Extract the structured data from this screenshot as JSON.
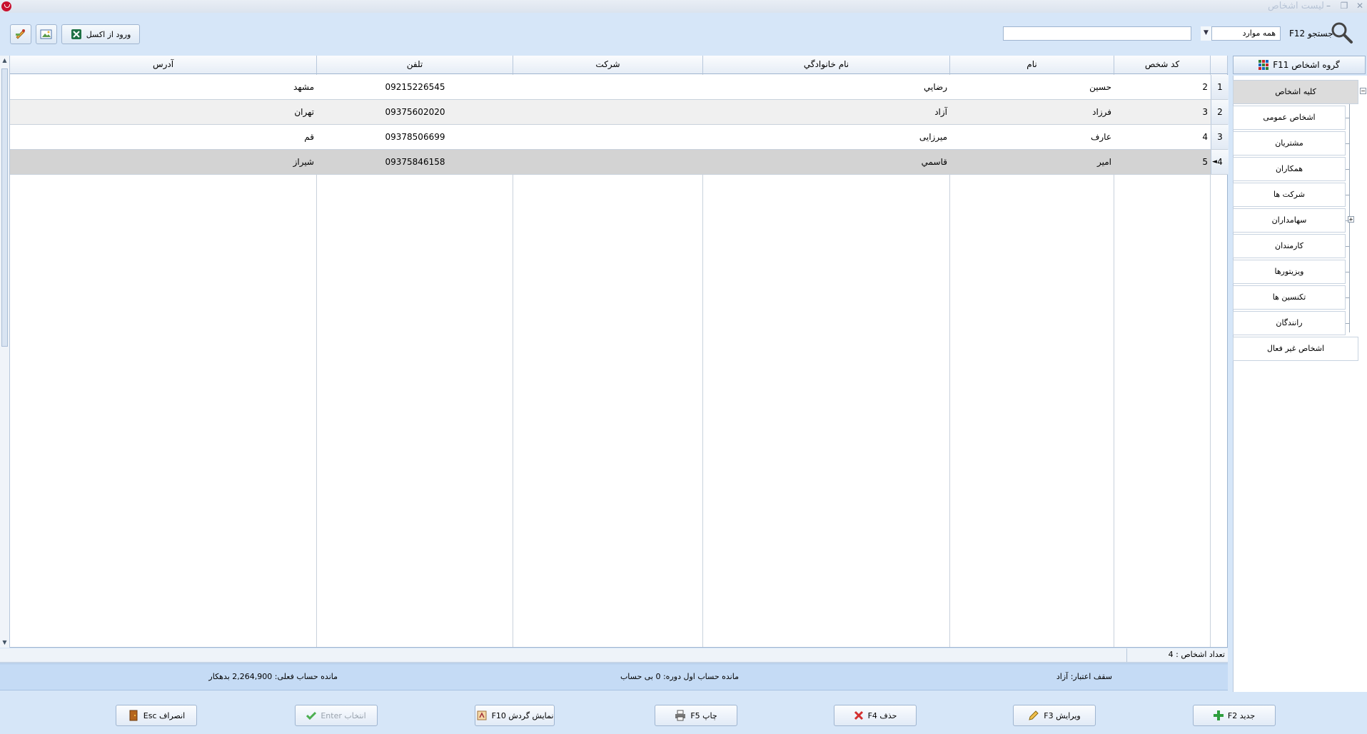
{
  "window": {
    "title": "لیست اشخاص"
  },
  "toolbar": {
    "excel_import_label": "ورود از اکسل",
    "search_label": "جستجو F12",
    "search_value": "",
    "search_placeholder": "",
    "scope_value": "همه موارد"
  },
  "sidebar": {
    "header": "گروه اشخاص F11",
    "items": [
      {
        "label": "کلیه اشخاص",
        "active": true
      },
      {
        "label": "اشخاص عمومی"
      },
      {
        "label": "مشتریان"
      },
      {
        "label": "همکاران"
      },
      {
        "label": "شرکت ها"
      },
      {
        "label": "سهامداران"
      },
      {
        "label": "کارمندان"
      },
      {
        "label": "ویزیتورها"
      },
      {
        "label": "تکنسین ها"
      },
      {
        "label": "رانندگان"
      },
      {
        "label": "اشخاص غیر فعال"
      }
    ]
  },
  "grid": {
    "headers": {
      "code": "کد شخص",
      "first_name": "نام",
      "last_name": "نام خانوادگي",
      "company": "شرکت",
      "phone": "تلفن",
      "address": "آدرس"
    },
    "rows": [
      {
        "n": "1",
        "code": "2",
        "first_name": "حسین",
        "last_name": "رضايي",
        "company": "",
        "phone": "09215226545",
        "address": "مشهد"
      },
      {
        "n": "2",
        "code": "3",
        "first_name": "فرزاد",
        "last_name": "آزاد",
        "company": "",
        "phone": "09375602020",
        "address": "تهران"
      },
      {
        "n": "3",
        "code": "4",
        "first_name": "عارف",
        "last_name": "میرزایی",
        "company": "",
        "phone": "09378506699",
        "address": "قم"
      },
      {
        "n": "4",
        "code": "5",
        "first_name": "امیر",
        "last_name": "قاسمي",
        "company": "",
        "phone": "09375846158",
        "address": "شیراز"
      }
    ]
  },
  "status": {
    "count": "تعداد اشخاص : 4",
    "credit_limit": "سقف اعتبار: آزاد",
    "opening_balance": "مانده حساب اول دوره: 0 بی حساب",
    "current_balance": "مانده حساب فعلی: 2,264,900 بدهکار"
  },
  "buttons": {
    "new": "جدید F2",
    "edit": "ویرایش F3",
    "delete": "حذف F4",
    "print": "چاپ F5",
    "turnover": "نمایش گردش F10",
    "select": "انتخاب Enter",
    "cancel": "انصراف Esc"
  },
  "colors": {
    "accent": "#c5dbf5",
    "selected_row": "#d3d3d3",
    "alt_row": "#f0f0f0"
  }
}
